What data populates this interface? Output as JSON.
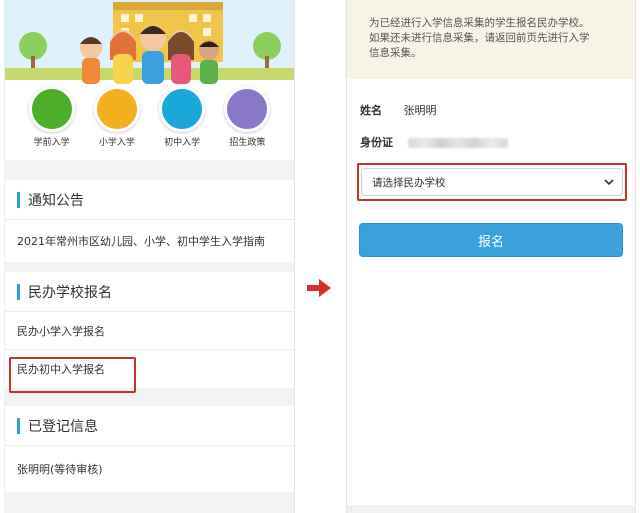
{
  "left": {
    "quick_links": [
      {
        "label": "学前入学",
        "icon": "sprout-icon",
        "color": "#4cae2a"
      },
      {
        "label": "小学入学",
        "icon": "leaf-icon",
        "color": "#f2b01e"
      },
      {
        "label": "初中入学",
        "icon": "tree-icon",
        "color": "#1aa7d9"
      },
      {
        "label": "招生政策",
        "icon": "book-reader-icon",
        "color": "#8a78c9"
      }
    ],
    "notice_section": {
      "title": "通知公告",
      "items": [
        "2021年常州市区幼儿园、小学、初中学生入学指南"
      ]
    },
    "private_section": {
      "title": "民办学校报名",
      "items": [
        "民办小学入学报名",
        "民办初中入学报名"
      ]
    },
    "registered_section": {
      "title": "已登记信息",
      "items": [
        "张明明(等待审核)"
      ]
    }
  },
  "right": {
    "notice_line1": "为已经进行入学信息采集的学生报名民办学校。",
    "notice_line2": "如果还未进行信息采集，请返回前页先进行入学",
    "notice_line3": "信息采集。",
    "name_label": "姓名",
    "name_value": "张明明",
    "id_label": "身份证",
    "select_placeholder": "请选择民办学校",
    "submit_label": "报名"
  },
  "colors": {
    "accent": "#2a9fd8",
    "button": "#3aa0de",
    "highlight": "#c9302c",
    "notice_bg": "#f7f3e7"
  }
}
